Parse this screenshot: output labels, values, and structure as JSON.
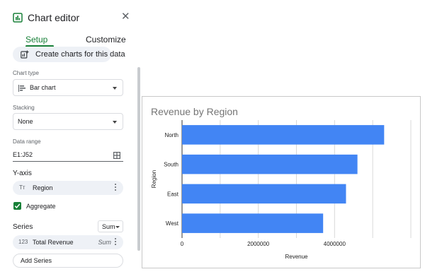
{
  "editor": {
    "title": "Chart editor",
    "tabs": [
      "Setup",
      "Customize"
    ],
    "create_button": "Create charts for this data",
    "chart_type": {
      "label": "Chart type",
      "value": "Bar chart"
    },
    "stacking": {
      "label": "Stacking",
      "value": "None"
    },
    "data_range": {
      "label": "Data range",
      "value": "E1:J52"
    },
    "y_axis": {
      "heading": "Y-axis",
      "field": "Region",
      "field_icon": "text-type-icon"
    },
    "aggregate": {
      "label": "Aggregate",
      "checked": true
    },
    "series": {
      "heading": "Series",
      "aggregation": "Sum",
      "item": "Total Revenue",
      "item_icon": "123",
      "item_aggregation": "Sum"
    },
    "add_series": "Add Series",
    "accent_color": "#188038"
  },
  "chart_data": {
    "type": "bar",
    "orientation": "horizontal",
    "title": "Revenue by Region",
    "xlabel": "Revenue",
    "ylabel": "Region",
    "categories": [
      "North",
      "South",
      "East",
      "West"
    ],
    "values": [
      5300000,
      4600000,
      4300000,
      3700000
    ],
    "xlim": [
      0,
      6000000
    ],
    "x_ticks": [
      0,
      2000000,
      4000000
    ],
    "x_tick_labels": [
      "0",
      "2000000",
      "4000000"
    ],
    "bar_color": "#4285f4",
    "grid": true
  }
}
